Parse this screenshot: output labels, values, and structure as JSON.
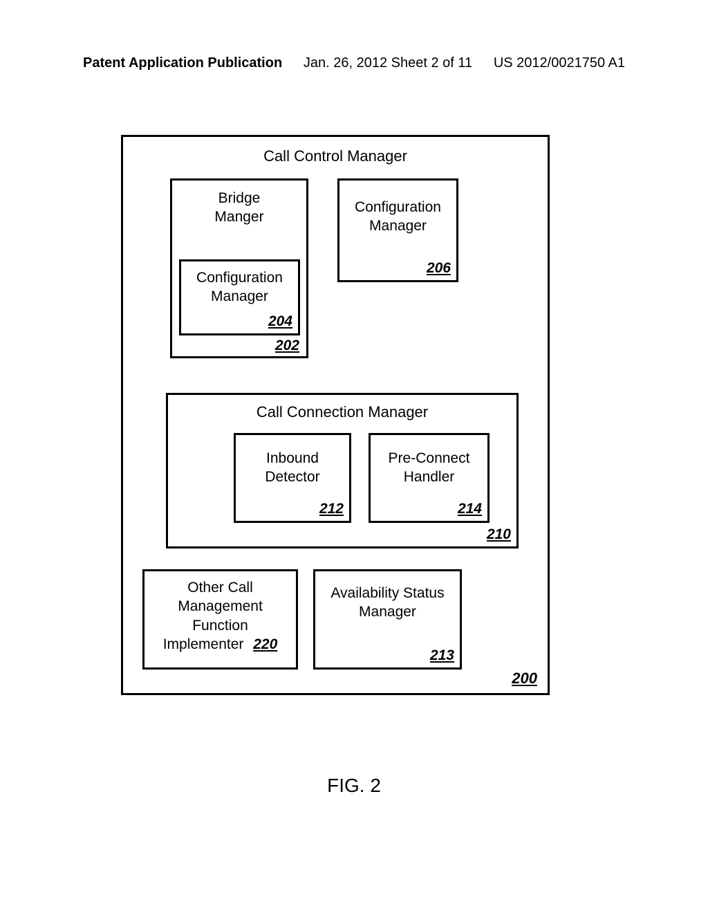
{
  "header": {
    "left": "Patent Application Publication",
    "center": "Jan. 26, 2012  Sheet 2 of 11",
    "right": "US 2012/0021750 A1"
  },
  "outer": {
    "title": "Call Control Manager",
    "ref": "200"
  },
  "bridge": {
    "title1": "Bridge",
    "title2": "Manger",
    "ref": "202",
    "inner": {
      "title1": "Configuration",
      "title2": "Manager",
      "ref": "204"
    }
  },
  "config": {
    "title1": "Configuration",
    "title2": "Manager",
    "ref": "206"
  },
  "ccm": {
    "title": "Call Connection Manager",
    "ref": "210",
    "inbound": {
      "title1": "Inbound",
      "title2": "Detector",
      "ref": "212"
    },
    "preconnect": {
      "title1": "Pre-Connect",
      "title2": "Handler",
      "ref": "214"
    }
  },
  "other": {
    "title1": "Other Call",
    "title2": "Management",
    "title3": "Function",
    "title4": "Implementer",
    "ref": "220"
  },
  "availability": {
    "title1": "Availability Status",
    "title2": "Manager",
    "ref": "213"
  },
  "figure": "FIG. 2"
}
